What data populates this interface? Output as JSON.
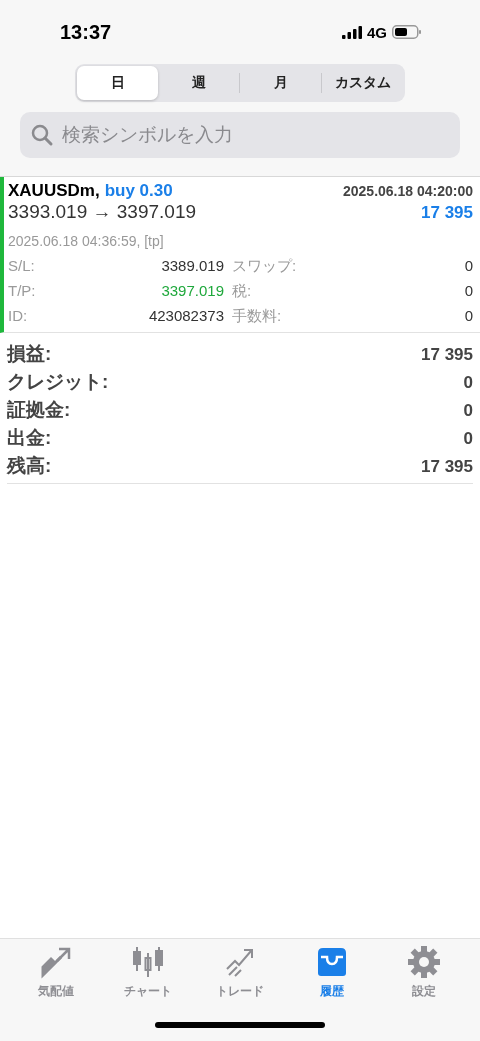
{
  "status_bar": {
    "time": "13:37",
    "network": "4G"
  },
  "period_tabs": [
    {
      "label": "日",
      "selected": true
    },
    {
      "label": "週",
      "selected": false
    },
    {
      "label": "月",
      "selected": false
    },
    {
      "label": "カスタム",
      "selected": false
    }
  ],
  "search": {
    "placeholder": "検索シンボルを入力"
  },
  "trade": {
    "symbol": "XAUUSDm,",
    "side": "buy 0.30",
    "open_time": "2025.06.18 04:20:00",
    "prices": "3393.019 → 3397.019",
    "profit": "17 395",
    "close_info": "2025.06.18 04:36:59, [tp]",
    "details": [
      {
        "label": "S/L:",
        "value": "3389.019",
        "highlight": false,
        "label_2": "スワップ:",
        "value_2": "0"
      },
      {
        "label": "T/P:",
        "value": "3397.019",
        "highlight": true,
        "label_2": "税:",
        "value_2": "0"
      },
      {
        "label": "ID:",
        "value": "423082373",
        "highlight": false,
        "label_2": "手数料:",
        "value_2": "0"
      }
    ]
  },
  "summary": [
    {
      "label": "損益:",
      "value": "17 395"
    },
    {
      "label": "クレジット:",
      "value": "0"
    },
    {
      "label": "証拠金:",
      "value": "0"
    },
    {
      "label": "出金:",
      "value": "0"
    },
    {
      "label": "残高:",
      "value": "17 395"
    }
  ],
  "tab_bar": [
    {
      "label": "気配値",
      "selected": false
    },
    {
      "label": "チャート",
      "selected": false
    },
    {
      "label": "トレード",
      "selected": false
    },
    {
      "label": "履歴",
      "selected": true
    },
    {
      "label": "設定",
      "selected": false
    }
  ]
}
